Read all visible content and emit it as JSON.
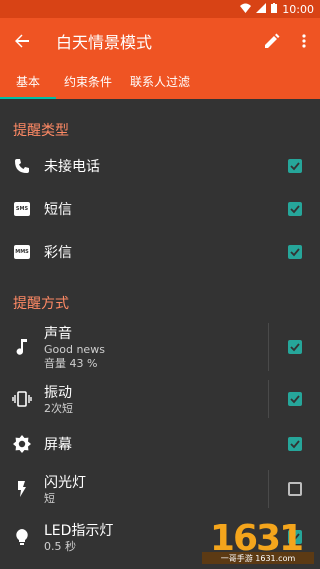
{
  "status": {
    "time": "10:00"
  },
  "appbar": {
    "title": "白天情景模式"
  },
  "tabs": [
    "基本",
    "约束条件",
    "联系人过滤"
  ],
  "section1": {
    "title": "提醒类型",
    "items": [
      {
        "label": "未接电话",
        "icon": "phone-icon",
        "checked": true
      },
      {
        "label": "短信",
        "icon": "sms-icon",
        "icon_text": "SMS",
        "checked": true
      },
      {
        "label": "彩信",
        "icon": "mms-icon",
        "icon_text": "MMS",
        "checked": true
      }
    ]
  },
  "section2": {
    "title": "提醒方式",
    "items": [
      {
        "label": "声音",
        "sub1": "Good news",
        "sub2": "音量 43 %",
        "icon": "music-note-icon",
        "checked": true
      },
      {
        "label": "振动",
        "sub1": "2次短",
        "icon": "vibrate-icon",
        "checked": true
      },
      {
        "label": "屏幕",
        "icon": "brightness-icon",
        "checked": true
      },
      {
        "label": "闪光灯",
        "sub1": "短",
        "icon": "flash-icon",
        "checked": false
      },
      {
        "label": "LED指示灯",
        "sub1": "0.5 秒",
        "icon": "bulb-icon",
        "checked": true
      }
    ]
  },
  "watermark": {
    "number": "1631",
    "tag": "一哥手游 1631.com"
  },
  "colors": {
    "appbar": "#ef5423",
    "accent": "#00bfa5",
    "section": "#ff8a65",
    "background": "#333333"
  }
}
